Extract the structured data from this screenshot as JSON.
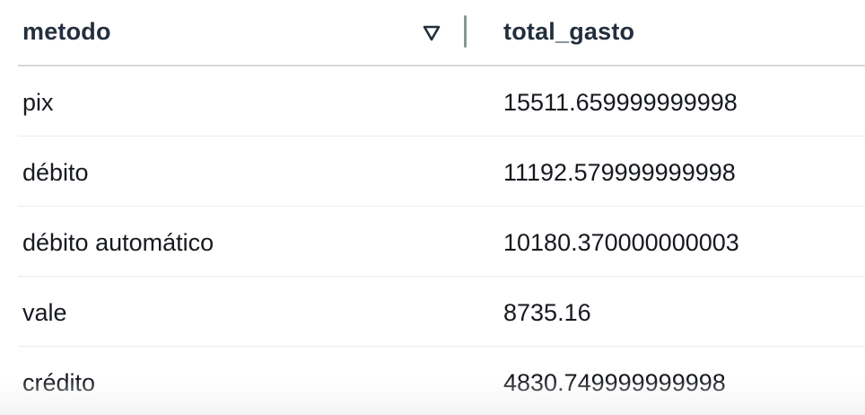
{
  "table": {
    "columns": [
      {
        "key": "metodo",
        "label": "metodo",
        "sortable": true
      },
      {
        "key": "total_gasto",
        "label": "total_gasto"
      }
    ],
    "sort_icon": "sort-descending-triangle-icon",
    "rows": [
      {
        "metodo": "pix",
        "total_gasto": "15511.659999999998"
      },
      {
        "metodo": "débito",
        "total_gasto": "11192.579999999998"
      },
      {
        "metodo": "débito automático",
        "total_gasto": "10180.370000000003"
      },
      {
        "metodo": "vale",
        "total_gasto": "8735.16"
      },
      {
        "metodo": "crédito",
        "total_gasto": "4830.749999999998"
      }
    ]
  },
  "colors": {
    "header_text": "#232f3e",
    "cell_text": "#16191f",
    "divider": "#879596",
    "row_border": "#e9ebed"
  }
}
